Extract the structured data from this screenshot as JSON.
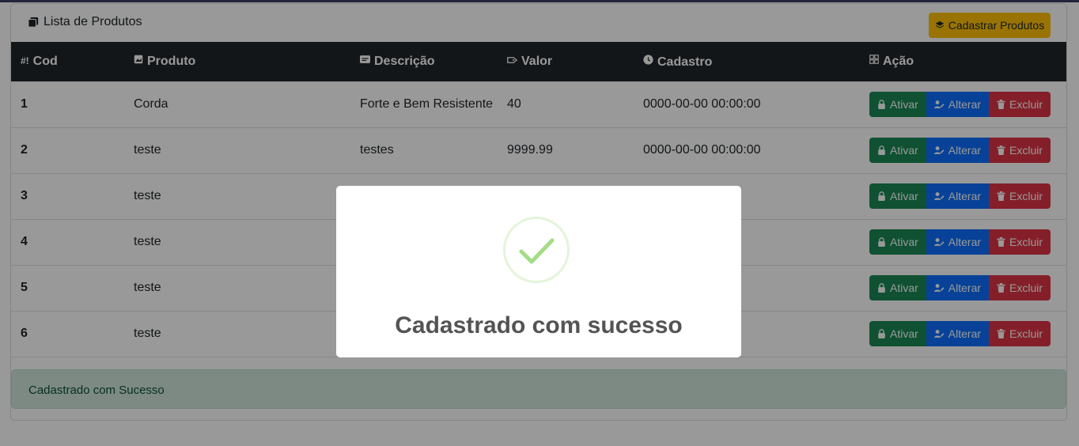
{
  "header": {
    "title": "Lista de Produtos",
    "register_button": "Cadastrar Produtos",
    "title_icon": "copy-icon",
    "register_icon": "layers-icon"
  },
  "table": {
    "columns": [
      {
        "label": "Cod",
        "icon": "hash-icon"
      },
      {
        "label": "Produto",
        "icon": "image-icon"
      },
      {
        "label": "Descrição",
        "icon": "card-text-icon"
      },
      {
        "label": "Valor",
        "icon": "tag-icon"
      },
      {
        "label": "Cadastro",
        "icon": "clock-icon"
      },
      {
        "label": "Ação",
        "icon": "grid-icon"
      }
    ],
    "rows": [
      {
        "cod": "1",
        "produto": "Corda",
        "descricao": "Forte e Bem Resistente",
        "valor": "40",
        "cadastro": "0000-00-00 00:00:00"
      },
      {
        "cod": "2",
        "produto": "teste",
        "descricao": "testes",
        "valor": "9999.99",
        "cadastro": "0000-00-00 00:00:00"
      },
      {
        "cod": "3",
        "produto": "teste",
        "descricao": "",
        "valor": "",
        "cadastro": ":00"
      },
      {
        "cod": "4",
        "produto": "teste",
        "descricao": "",
        "valor": "",
        "cadastro": ":00"
      },
      {
        "cod": "5",
        "produto": "teste",
        "descricao": "",
        "valor": "",
        "cadastro": ":00"
      },
      {
        "cod": "6",
        "produto": "teste",
        "descricao": "",
        "valor": "",
        "cadastro": ":00"
      }
    ],
    "actions": {
      "activate": "Ativar",
      "edit": "Alterar",
      "delete": "Excluir"
    }
  },
  "alert": {
    "text": "Cadastrado com Sucesso"
  },
  "modal": {
    "title": "Cadastrado com sucesso",
    "icon": "check-icon",
    "icon_color": "#a5dc86"
  },
  "colors": {
    "header_bg": "#212529",
    "warning": "#ffc107",
    "success": "#198754",
    "primary": "#0d6efd",
    "danger": "#dc3545",
    "alert_bg": "#d1e7dd"
  }
}
